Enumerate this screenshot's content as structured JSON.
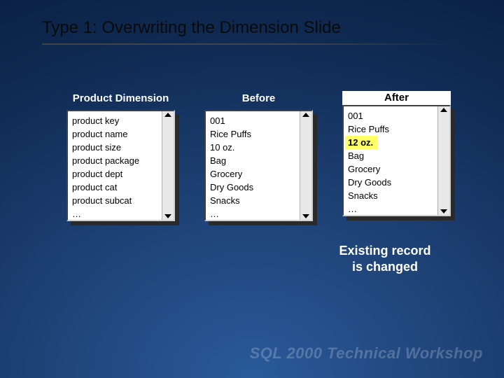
{
  "title": "Type 1: Overwriting the Dimension Slide",
  "columns": {
    "dimension": {
      "header": "Product Dimension",
      "rows": [
        "product key",
        "product name",
        "product size",
        "product package",
        "product dept",
        "product cat",
        "product subcat",
        "…"
      ]
    },
    "before": {
      "header": "Before",
      "rows": [
        "001",
        "Rice Puffs",
        "10 oz.",
        "Bag",
        "Grocery",
        "Dry Goods",
        "Snacks",
        "…"
      ]
    },
    "after": {
      "header": "After",
      "rows": [
        "001",
        "Rice Puffs",
        "12 oz.",
        "Bag",
        "Grocery",
        "Dry Goods",
        "Snacks",
        "…"
      ],
      "highlight_index": 2
    }
  },
  "caption_line1": "Existing record",
  "caption_line2": "is changed",
  "footer": "SQL 2000 Technical Workshop"
}
